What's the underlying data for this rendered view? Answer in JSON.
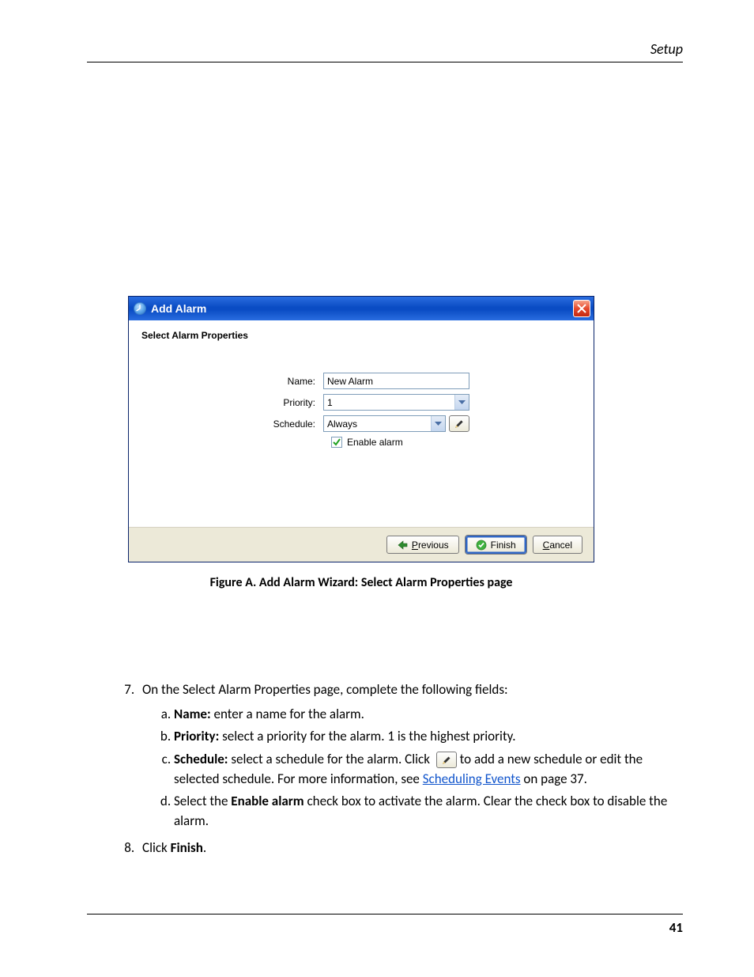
{
  "page": {
    "header": "Setup",
    "number": "41"
  },
  "dialog": {
    "title": "Add Alarm",
    "heading": "Select Alarm Properties",
    "labels": {
      "name": "Name:",
      "priority": "Priority:",
      "schedule": "Schedule:"
    },
    "fields": {
      "name_value": "New Alarm",
      "priority_value": "1",
      "schedule_value": "Always"
    },
    "checkbox": {
      "label": "Enable alarm",
      "checked": true
    },
    "buttons": {
      "previous_prefix": "P",
      "previous_suffix": "revious",
      "finish": "Finish",
      "cancel_prefix": "C",
      "cancel_suffix": "ancel"
    }
  },
  "figure_caption": "Figure A.  Add Alarm Wizard: Select Alarm Properties page",
  "body": {
    "step_lead_7a": "On the Select Alarm Properties page, complete the following fields:",
    "item_name_label": "Name:",
    "item_name_text": " enter a name for the alarm.",
    "item_priority_label": "Priority:",
    "item_priority_text": " select a priority for the alarm. 1 is the highest priority.",
    "item_schedule_label": "Schedule:",
    "item_schedule_text": " select a schedule for the alarm. Click ",
    "item_schedule_after_icon": " to add a new schedule or edit the selected schedule. For more information, see ",
    "item_schedule_link": "Scheduling Events",
    "item_schedule_link_page": " on page 37.",
    "item_enable_text": "Select the ",
    "item_enable_bold": "Enable alarm",
    "item_enable_tail": " check box to activate the alarm. Clear the check box to disable the alarm.",
    "step_7b": "Click ",
    "step_7b_bold": "Finish",
    "step_7b_tail": "."
  }
}
